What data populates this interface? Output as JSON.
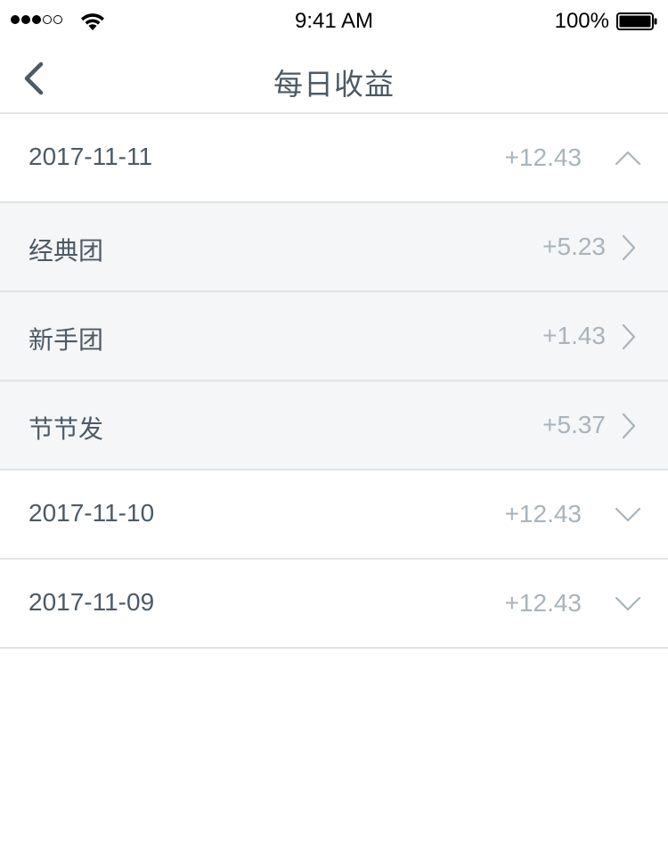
{
  "status_bar": {
    "time": "9:41 AM",
    "battery_percent": "100%",
    "signal_bars_filled": 3,
    "signal_bars_total": 5
  },
  "nav": {
    "title": "每日收益",
    "back_icon": "chevron-left-icon"
  },
  "colors": {
    "text_primary": "#4c5a66",
    "text_amount": "#a9b4bb",
    "sub_row_background": "#f5f6f8",
    "divider": "#e1e3e5"
  },
  "days": [
    {
      "date": "2017-11-11",
      "amount": "+12.43",
      "expanded": true,
      "items": [
        {
          "name": "经典团",
          "amount": "+5.23"
        },
        {
          "name": "新手团",
          "amount": "+1.43"
        },
        {
          "name": "节节发",
          "amount": "+5.37"
        }
      ]
    },
    {
      "date": "2017-11-10",
      "amount": "+12.43",
      "expanded": false
    },
    {
      "date": "2017-11-09",
      "amount": "+12.43",
      "expanded": false
    }
  ]
}
